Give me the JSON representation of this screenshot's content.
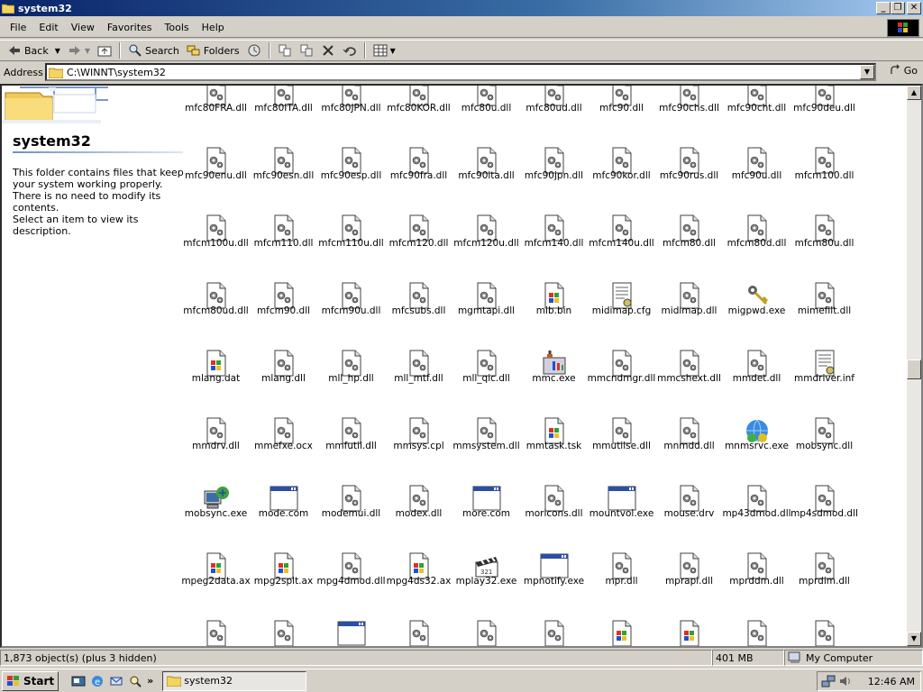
{
  "window": {
    "title": "system32"
  },
  "menu": [
    "File",
    "Edit",
    "View",
    "Favorites",
    "Tools",
    "Help"
  ],
  "toolbar": {
    "back": "Back",
    "search": "Search",
    "folders": "Folders"
  },
  "address": {
    "label": "Address",
    "value": "C:\\WINNT\\system32",
    "go": "Go"
  },
  "leftpanel": {
    "title": "system32",
    "description": "This folder contains files that keep your system working properly. There is no need to modify its contents.",
    "select_hint": "Select an item to view its description."
  },
  "files": [
    {
      "name": "mfc80FRA.dll",
      "icon": "dll-gear-icon"
    },
    {
      "name": "mfc80ITA.dll",
      "icon": "dll-gear-icon"
    },
    {
      "name": "mfc80JPN.dll",
      "icon": "dll-gear-icon"
    },
    {
      "name": "mfc80KOR.dll",
      "icon": "dll-gear-icon"
    },
    {
      "name": "mfc80u.dll",
      "icon": "dll-gear-icon"
    },
    {
      "name": "mfc80ud.dll",
      "icon": "dll-gear-icon"
    },
    {
      "name": "mfc90.dll",
      "icon": "dll-gear-icon"
    },
    {
      "name": "mfc90chs.dll",
      "icon": "dll-gear-icon"
    },
    {
      "name": "mfc90cht.dll",
      "icon": "dll-gear-icon"
    },
    {
      "name": "mfc90deu.dll",
      "icon": "dll-gear-icon"
    },
    {
      "name": "mfc90enu.dll",
      "icon": "dll-gear-icon"
    },
    {
      "name": "mfc90esn.dll",
      "icon": "dll-gear-icon"
    },
    {
      "name": "mfc90esp.dll",
      "icon": "dll-gear-icon"
    },
    {
      "name": "mfc90fra.dll",
      "icon": "dll-gear-icon"
    },
    {
      "name": "mfc90ita.dll",
      "icon": "dll-gear-icon"
    },
    {
      "name": "mfc90jpn.dll",
      "icon": "dll-gear-icon"
    },
    {
      "name": "mfc90kor.dll",
      "icon": "dll-gear-icon"
    },
    {
      "name": "mfc90rus.dll",
      "icon": "dll-gear-icon"
    },
    {
      "name": "mfc90u.dll",
      "icon": "dll-gear-icon"
    },
    {
      "name": "mfcm100.dll",
      "icon": "dll-gear-icon"
    },
    {
      "name": "mfcm100u.dll",
      "icon": "dll-gear-icon"
    },
    {
      "name": "mfcm110.dll",
      "icon": "dll-gear-icon"
    },
    {
      "name": "mfcm110u.dll",
      "icon": "dll-gear-icon"
    },
    {
      "name": "mfcm120.dll",
      "icon": "dll-gear-icon"
    },
    {
      "name": "mfcm120u.dll",
      "icon": "dll-gear-icon"
    },
    {
      "name": "mfcm140.dll",
      "icon": "dll-gear-icon"
    },
    {
      "name": "mfcm140u.dll",
      "icon": "dll-gear-icon"
    },
    {
      "name": "mfcm80.dll",
      "icon": "dll-gear-icon"
    },
    {
      "name": "mfcm80d.dll",
      "icon": "dll-gear-icon"
    },
    {
      "name": "mfcm80u.dll",
      "icon": "dll-gear-icon"
    },
    {
      "name": "mfcm80ud.dll",
      "icon": "dll-gear-icon"
    },
    {
      "name": "mfcm90.dll",
      "icon": "dll-gear-icon"
    },
    {
      "name": "mfcm90u.dll",
      "icon": "dll-gear-icon"
    },
    {
      "name": "mfcsubs.dll",
      "icon": "dll-gear-icon"
    },
    {
      "name": "mgmtapi.dll",
      "icon": "dll-gear-icon"
    },
    {
      "name": "mib.bin",
      "icon": "windows-file-icon"
    },
    {
      "name": "midimap.cfg",
      "icon": "config-file-icon"
    },
    {
      "name": "midimap.dll",
      "icon": "dll-gear-icon"
    },
    {
      "name": "migpwd.exe",
      "icon": "keys-icon"
    },
    {
      "name": "mimefilt.dll",
      "icon": "dll-gear-icon"
    },
    {
      "name": "mlang.dat",
      "icon": "windows-file-icon"
    },
    {
      "name": "mlang.dll",
      "icon": "dll-gear-icon"
    },
    {
      "name": "mll_hp.dll",
      "icon": "dll-gear-icon"
    },
    {
      "name": "mll_mtf.dll",
      "icon": "dll-gear-icon"
    },
    {
      "name": "mll_qic.dll",
      "icon": "dll-gear-icon"
    },
    {
      "name": "mmc.exe",
      "icon": "mmc-toolbox-icon"
    },
    {
      "name": "mmcndmgr.dll",
      "icon": "dll-gear-icon"
    },
    {
      "name": "mmcshext.dll",
      "icon": "dll-gear-icon"
    },
    {
      "name": "mmdet.dll",
      "icon": "dll-gear-icon"
    },
    {
      "name": "mmdriver.inf",
      "icon": "config-file-icon"
    },
    {
      "name": "mmdrv.dll",
      "icon": "dll-gear-icon"
    },
    {
      "name": "mmefxe.ocx",
      "icon": "dll-gear-icon"
    },
    {
      "name": "mmfutil.dll",
      "icon": "dll-gear-icon"
    },
    {
      "name": "mmsys.cpl",
      "icon": "dll-gear-icon"
    },
    {
      "name": "mmsystem.dll",
      "icon": "dll-gear-icon"
    },
    {
      "name": "mmtask.tsk",
      "icon": "windows-file-icon"
    },
    {
      "name": "mmutilse.dll",
      "icon": "dll-gear-icon"
    },
    {
      "name": "mnmdd.dll",
      "icon": "dll-gear-icon"
    },
    {
      "name": "mnmsrvc.exe",
      "icon": "netmeeting-icon"
    },
    {
      "name": "mobsync.dll",
      "icon": "dll-gear-icon"
    },
    {
      "name": "mobsync.exe",
      "icon": "sync-computer-icon"
    },
    {
      "name": "mode.com",
      "icon": "window-app-icon"
    },
    {
      "name": "modemui.dll",
      "icon": "dll-gear-icon"
    },
    {
      "name": "modex.dll",
      "icon": "dll-gear-icon"
    },
    {
      "name": "more.com",
      "icon": "window-app-icon"
    },
    {
      "name": "moricons.dll",
      "icon": "dll-gear-icon"
    },
    {
      "name": "mountvol.exe",
      "icon": "window-app-icon"
    },
    {
      "name": "mouse.drv",
      "icon": "dll-gear-icon"
    },
    {
      "name": "mp43dmod.dll",
      "icon": "dll-gear-icon"
    },
    {
      "name": "mp4sdmod.dll",
      "icon": "dll-gear-icon"
    },
    {
      "name": "mpeg2data.ax",
      "icon": "windows-file-icon"
    },
    {
      "name": "mpg2splt.ax",
      "icon": "windows-file-icon"
    },
    {
      "name": "mpg4dmod.dll",
      "icon": "dll-gear-icon"
    },
    {
      "name": "mpg4ds32.ax",
      "icon": "windows-file-icon"
    },
    {
      "name": "mplay32.exe",
      "icon": "clapper-icon"
    },
    {
      "name": "mpnotify.exe",
      "icon": "window-app-icon"
    },
    {
      "name": "mpr.dll",
      "icon": "dll-gear-icon"
    },
    {
      "name": "mprapi.dll",
      "icon": "dll-gear-icon"
    },
    {
      "name": "mprddm.dll",
      "icon": "dll-gear-icon"
    },
    {
      "name": "mprdim.dll",
      "icon": "dll-gear-icon"
    },
    {
      "name": "",
      "icon": "dll-gear-icon"
    },
    {
      "name": "",
      "icon": "dll-gear-icon"
    },
    {
      "name": "",
      "icon": "window-app-icon"
    },
    {
      "name": "",
      "icon": "dll-gear-icon"
    },
    {
      "name": "",
      "icon": "dll-gear-icon"
    },
    {
      "name": "",
      "icon": "dll-gear-icon"
    },
    {
      "name": "",
      "icon": "windows-file-icon"
    },
    {
      "name": "",
      "icon": "windows-file-icon"
    },
    {
      "name": "",
      "icon": "dll-gear-icon"
    },
    {
      "name": "",
      "icon": "dll-gear-icon"
    }
  ],
  "status": {
    "objects": "1,873 object(s) (plus 3 hidden)",
    "size": "401 MB",
    "zone": "My Computer"
  },
  "taskbar": {
    "start": "Start",
    "task": "system32",
    "clock": "12:46 AM"
  }
}
